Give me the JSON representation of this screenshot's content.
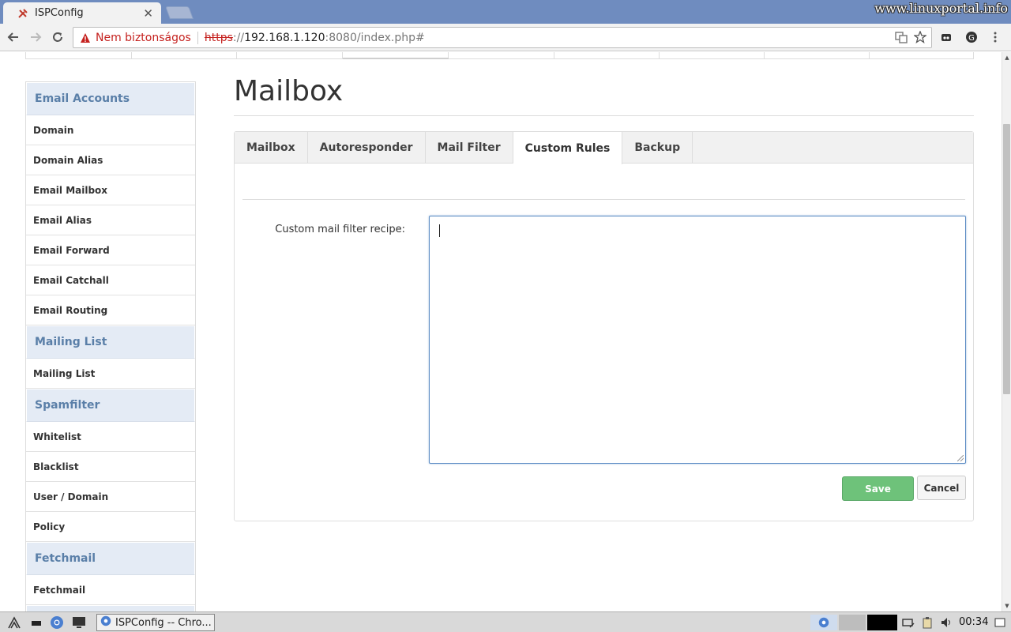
{
  "browser": {
    "tab_title": "ISPConfig",
    "watermark": "www.linuxportal.info",
    "not_secure": "Nem biztonságos",
    "url_scheme": "https",
    "url_sep": "://",
    "url_host": "192.168.1.120",
    "url_path": ":8080/index.php#"
  },
  "sidebar": {
    "sections": [
      {
        "title": "Email Accounts",
        "items": [
          "Domain",
          "Domain Alias",
          "Email Mailbox",
          "Email Alias",
          "Email Forward",
          "Email Catchall",
          "Email Routing"
        ]
      },
      {
        "title": "Mailing List",
        "items": [
          "Mailing List"
        ]
      },
      {
        "title": "Spamfilter",
        "items": [
          "Whitelist",
          "Blacklist",
          "User / Domain",
          "Policy"
        ]
      },
      {
        "title": "Fetchmail",
        "items": [
          "Fetchmail"
        ]
      }
    ]
  },
  "main": {
    "title": "Mailbox",
    "tabs": [
      {
        "label": "Mailbox",
        "active": false
      },
      {
        "label": "Autoresponder",
        "active": false
      },
      {
        "label": "Mail Filter",
        "active": false
      },
      {
        "label": "Custom Rules",
        "active": true
      },
      {
        "label": "Backup",
        "active": false
      }
    ],
    "recipe_label": "Custom mail filter recipe:",
    "recipe_value": "",
    "save_label": "Save",
    "cancel_label": "Cancel"
  },
  "taskbar": {
    "window_title": "ISPConfig -- Chro...",
    "clock": "00:34"
  },
  "colors": {
    "accent": "#5a7fa8",
    "save_green": "#6ec27a",
    "tab_strip": "#6f8cbf"
  }
}
